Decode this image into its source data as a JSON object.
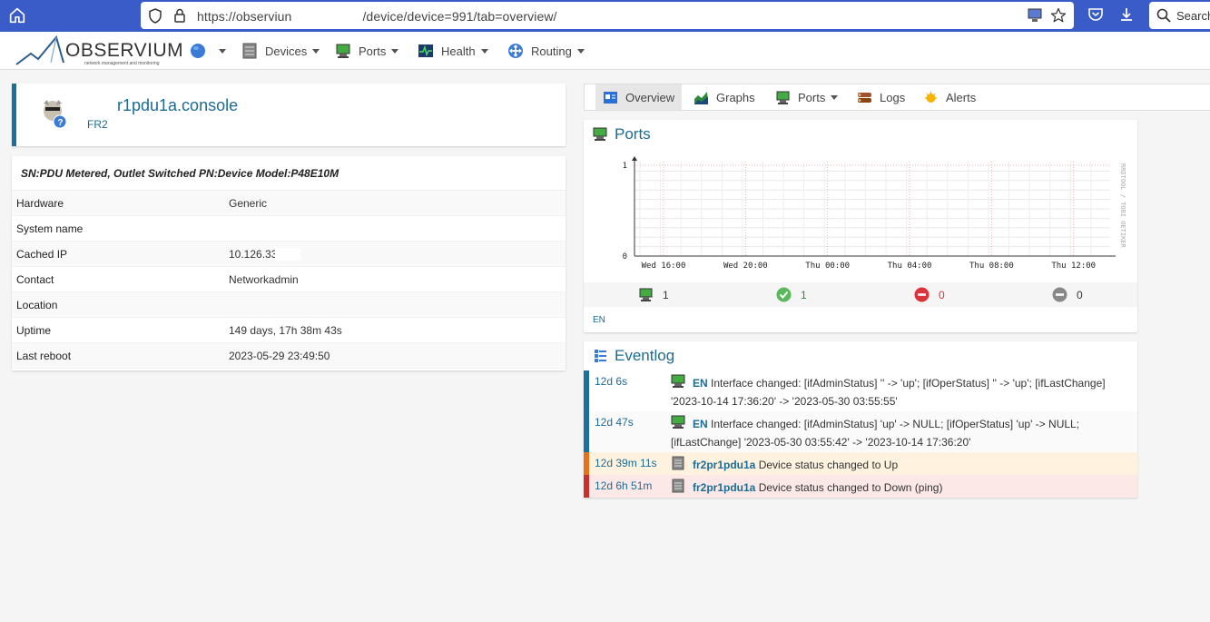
{
  "browser": {
    "url_prefix": "https://observiun",
    "url_suffix": "/device/device=991/tab=overview/",
    "search_label": "Search"
  },
  "nav": {
    "logo_text": "OBSERVIUM",
    "logo_sub": "network management and monitoring",
    "devices": "Devices",
    "ports": "Ports",
    "health": "Health",
    "routing": "Routing"
  },
  "device": {
    "name": "r1pdu1a.console",
    "location": "FR2"
  },
  "info": {
    "title": "SN:PDU Metered, Outlet Switched PN:Device Model:P48E10M",
    "rows": [
      {
        "label": "Hardware",
        "value": "Generic"
      },
      {
        "label": "System name",
        "value": ""
      },
      {
        "label": "Cached IP",
        "value": "10.126.33."
      },
      {
        "label": "Contact",
        "value": "Networkadmin"
      },
      {
        "label": "Location",
        "value": ""
      },
      {
        "label": "Uptime",
        "value": "149 days, 17h 38m 43s"
      },
      {
        "label": "Last reboot",
        "value": "2023-05-29 23:49:50"
      }
    ]
  },
  "tabs": {
    "overview": "Overview",
    "graphs": "Graphs",
    "ports": "Ports",
    "logs": "Logs",
    "alerts": "Alerts"
  },
  "ports_box": {
    "title": "Ports",
    "total": "1",
    "up": "1",
    "down": "0",
    "disabled": "0",
    "link": "EN"
  },
  "chart_data": {
    "type": "line",
    "x": [
      "Wed 16:00",
      "Wed 20:00",
      "Thu 00:00",
      "Thu 04:00",
      "Thu 08:00",
      "Thu 12:00"
    ],
    "y_ticks": [
      "1",
      "0"
    ],
    "ylim": [
      0,
      1
    ],
    "watermark": "RRDTOOL / TOBI OETIKER",
    "grid": true,
    "series": []
  },
  "eventlog": {
    "title": "Eventlog",
    "entries": [
      {
        "time": "12d 6s",
        "entity": "EN",
        "text": "Interface changed: [ifAdminStatus] '' -> 'up'; [ifOperStatus] '' -> 'up'; [ifLastChange] '2023-10-14 17:36:20' -> '2023-05-30 03:55:55'"
      },
      {
        "time": "12d 47s",
        "entity": "EN",
        "text": "Interface changed: [ifAdminStatus] 'up' -> NULL; [ifOperStatus] 'up' -> NULL; [ifLastChange] '2023-05-30 03:55:42' -> '2023-10-14 17:36:20'"
      },
      {
        "time": "12d 39m 11s",
        "entity": "fr2pr1pdu1a",
        "text": "Device status changed to Up"
      },
      {
        "time": "12d 6h 51m",
        "entity": "fr2pr1pdu1a",
        "text": "Device status changed to Down (ping)"
      }
    ]
  },
  "colors": {
    "browser_bar": "#3a5cc8",
    "accent": "#1c6b94",
    "info_bar": "#1a6f9c",
    "up_row": "#fff3e0",
    "down_row": "#fde8e8"
  }
}
